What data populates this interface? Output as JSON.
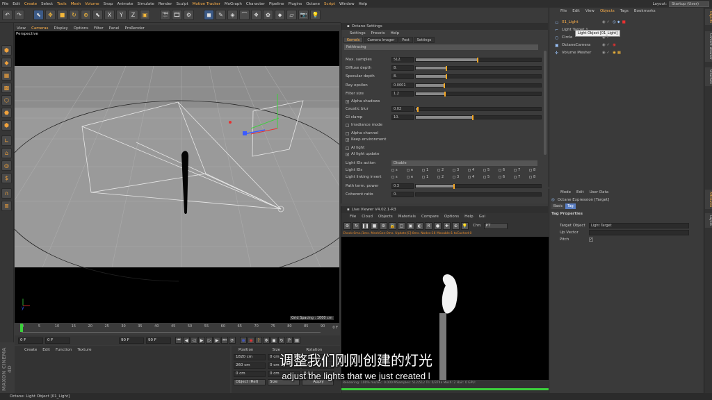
{
  "menubar": {
    "items": [
      "File",
      "Edit",
      "Create",
      "Select",
      "Tools",
      "Mesh",
      "Volume",
      "Snap",
      "Animate",
      "Simulate",
      "Render",
      "Sculpt",
      "Motion Tracker",
      "MoGraph",
      "Character",
      "Pipeline",
      "Plugins",
      "Octane",
      "Script",
      "Window",
      "Help"
    ],
    "layout_label": "Layout:",
    "layout_value": "Startup (User)"
  },
  "toolbar": {
    "axis_x": "X",
    "axis_y": "Y",
    "axis_z": "Z"
  },
  "viewport": {
    "menu": [
      "View",
      "Cameras",
      "Display",
      "Options",
      "Filter",
      "Panel",
      "ProRender"
    ],
    "label": "Perspective",
    "grid_spacing": "Grid Spacing : 1000 cm"
  },
  "timeline": {
    "ticks": [
      "0",
      "5",
      "10",
      "15",
      "20",
      "25",
      "30",
      "35",
      "40",
      "45",
      "50",
      "55",
      "60",
      "65",
      "70",
      "75",
      "80",
      "85",
      "90"
    ],
    "end_label": "0 F",
    "frame_current": "0 F",
    "frame_start": "0 F",
    "frame_end": "90 F",
    "frame_max": "90 F"
  },
  "material_manager": {
    "menu": [
      "Create",
      "Edit",
      "Function",
      "Texture"
    ]
  },
  "coordinates": {
    "headers": [
      "Position",
      "Size",
      "Rotation"
    ],
    "rows": [
      [
        "1820 cm",
        "0 cm",
        "H 0 °"
      ],
      [
        "260 cm",
        "0 cm",
        "P 0 °"
      ],
      [
        "0 cm",
        "0 cm",
        "B 0 °"
      ]
    ],
    "mode": "Object (Rel)",
    "size_mode": "Size",
    "apply": "Apply"
  },
  "logo": "MAXON CINEMA 4D",
  "status_bar": {
    "text": "Octane:     Light Object [01_Light]"
  },
  "octane_settings": {
    "title": "Octane Settings",
    "menu": [
      "Settings",
      "Presets",
      "Help"
    ],
    "tabs": [
      "Kernels",
      "Camera Imager",
      "Post",
      "Settings"
    ],
    "kernel": "Pathtracing",
    "params": [
      {
        "label": "Max. samples",
        "value": "512.",
        "fill": 0.49
      },
      {
        "label": "Diffuse depth",
        "value": "8.",
        "fill": 0.24
      },
      {
        "label": "Specular depth",
        "value": "8.",
        "fill": 0.24
      },
      {
        "label": "Ray epsilon",
        "value": "0.0001",
        "fill": 0.22
      },
      {
        "label": "Filter size",
        "value": "1.2",
        "fill": 0.23
      }
    ],
    "alpha_shadows": "Alpha shadows",
    "params2": [
      {
        "label": "Caustic blur",
        "value": "0.02",
        "fill": 0.01
      },
      {
        "label": "GI clamp",
        "value": "10.",
        "fill": 0.45
      }
    ],
    "irradiance_mode": "Irradiance mode",
    "alpha_channel": "Alpha channel",
    "keep_environment": "Keep environment",
    "ai_light": "AI light",
    "ai_light_update": "AI light update",
    "light_ids_action_label": "Light IDs action",
    "light_ids_action_value": "Disable",
    "light_ids_label": "Light IDs",
    "light_linking_label": "Light linking invert",
    "channels": [
      "s",
      "e",
      "1",
      "2",
      "3",
      "4",
      "5",
      "6",
      "7",
      "8"
    ],
    "path_term_label": "Path term. power",
    "path_term_value": "0.3",
    "path_term_fill": 0.3,
    "coherent_label": "Coherent ratio",
    "coherent_value": "0."
  },
  "live_viewer": {
    "title": "Live Viewer V4.02.1-R3",
    "menu": [
      "File",
      "Cloud",
      "Objects",
      "Materials",
      "Compare",
      "Options",
      "Help",
      "Gui"
    ],
    "chn_label": "Chn:",
    "chn_value": "PT",
    "status": "Check:0ms./1ms. MeshGen:0ms. Update[C]:0ms. Nodes:16 Movable:1 txCached:0",
    "footer": "Rendering: 100% ms/sec: 0.000 MSamples: 512/512   Tri: 0/374k   Mesh: 2   Hair: 0   GPU:"
  },
  "object_manager": {
    "menu": [
      "File",
      "Edit",
      "View",
      "Objects",
      "Tags",
      "Bookmarks"
    ],
    "objects": [
      "01_Light",
      "Light Target.1",
      "Circle",
      "OctaneCamera",
      "Volume Mesher"
    ],
    "tooltip": "Light Object [01_Light]"
  },
  "attribute_manager": {
    "menu": [
      "Mode",
      "Edit",
      "User Data"
    ],
    "title": "Octane Expression [Target]",
    "tabs": [
      "Basic",
      "Tag"
    ],
    "section": "Tag Properties",
    "rows": [
      {
        "label": "Target Object",
        "value": "Light Target"
      },
      {
        "label": "Up Vector",
        "value": ""
      },
      {
        "label": "Pitch",
        "value": "✓"
      }
    ]
  },
  "right_tabs": [
    "Objects",
    "Content Browser",
    "Structure",
    "Attributes",
    "Layers"
  ],
  "subtitle": {
    "cn": "调整我们刚刚创建的灯光",
    "en": "adjust the lights that we just created l"
  },
  "colors": {
    "accent": "#ffb14a",
    "selection": "#5a7ec2"
  }
}
